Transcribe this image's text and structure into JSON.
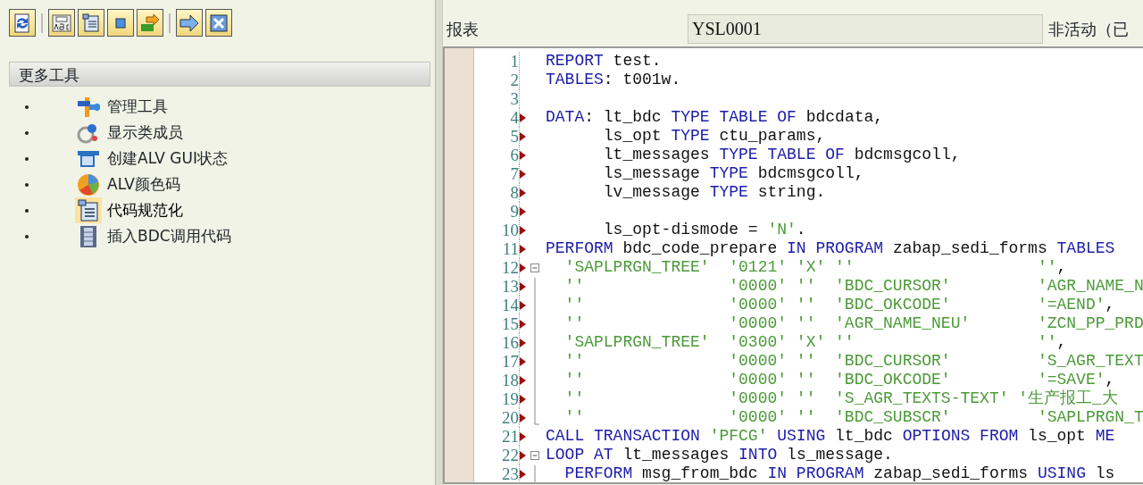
{
  "toolbar": {
    "buttons": [
      {
        "separator_before": false
      },
      {
        "separator_before": true
      },
      {
        "separator_before": false
      },
      {
        "separator_before": false
      },
      {
        "separator_before": false
      },
      {
        "separator_before": true
      },
      {
        "separator_before": false
      }
    ]
  },
  "tools_panel": {
    "title": "更多工具",
    "items": [
      {
        "label": "管理工具",
        "selected": false
      },
      {
        "label": "显示类成员",
        "selected": false
      },
      {
        "label": "创建ALV GUI状态",
        "selected": false
      },
      {
        "label": "ALV颜色码",
        "selected": false
      },
      {
        "label": "代码规范化",
        "selected": true
      },
      {
        "label": "插入BDC调用代码",
        "selected": false
      }
    ]
  },
  "editor_header": {
    "label": "报表",
    "program": "YSL0001",
    "status": "非活动（已"
  },
  "code_lines": [
    {
      "number": "1",
      "marked": false,
      "kind": "plain",
      "tokens": [
        {
          "kind": "keyword",
          "text": "REPORT"
        },
        {
          "kind": "text",
          "text": " test."
        }
      ]
    },
    {
      "number": "2",
      "marked": false,
      "kind": "plain",
      "tokens": [
        {
          "kind": "keyword",
          "text": "TABLES"
        },
        {
          "kind": "text",
          "text": ": t001w."
        }
      ]
    },
    {
      "number": "3",
      "marked": false,
      "kind": "plain"
    },
    {
      "number": "4",
      "marked": true,
      "kind": "plain",
      "tokens": [
        {
          "kind": "keyword",
          "text": "DATA"
        },
        {
          "kind": "text",
          "text": ": lt_bdc "
        },
        {
          "kind": "keyword",
          "text": "TYPE TABLE OF"
        },
        {
          "kind": "text",
          "text": " bdcdata,"
        }
      ]
    },
    {
      "number": "5",
      "marked": true,
      "kind": "plain",
      "tokens": [
        {
          "kind": "text",
          "text": "      ls_opt "
        },
        {
          "kind": "keyword",
          "text": "TYPE"
        },
        {
          "kind": "text",
          "text": " ctu_params,"
        }
      ]
    },
    {
      "number": "6",
      "marked": true,
      "kind": "plain",
      "tokens": [
        {
          "kind": "text",
          "text": "      lt_messages "
        },
        {
          "kind": "keyword",
          "text": "TYPE TABLE OF"
        },
        {
          "kind": "text",
          "text": " bdcmsgcoll,"
        }
      ]
    },
    {
      "number": "7",
      "marked": true,
      "kind": "plain",
      "tokens": [
        {
          "kind": "text",
          "text": "      ls_message "
        },
        {
          "kind": "keyword",
          "text": "TYPE"
        },
        {
          "kind": "text",
          "text": " bdcmsgcoll,"
        }
      ]
    },
    {
      "number": "8",
      "marked": true,
      "kind": "plain",
      "tokens": [
        {
          "kind": "text",
          "text": "      lv_message "
        },
        {
          "kind": "keyword",
          "text": "TYPE"
        },
        {
          "kind": "text",
          "text": " string."
        }
      ]
    },
    {
      "number": "9",
      "marked": true,
      "kind": "plain"
    },
    {
      "number": "10",
      "marked": true,
      "kind": "plain",
      "tokens": [
        {
          "kind": "text",
          "text": "      ls_opt-dismode = "
        },
        {
          "kind": "string",
          "text": "'N'"
        },
        {
          "kind": "text",
          "text": "."
        }
      ]
    },
    {
      "number": "11",
      "marked": true,
      "kind": "plain",
      "tokens": [
        {
          "kind": "keyword",
          "text": "PERFORM"
        },
        {
          "kind": "text",
          "text": " bdc_code_prepare "
        },
        {
          "kind": "keyword",
          "text": "IN PROGRAM"
        },
        {
          "kind": "text",
          "text": " zabap_sedi_forms "
        },
        {
          "kind": "keyword",
          "text": "TABLES"
        }
      ]
    },
    {
      "number": "12",
      "marked": true,
      "kind": "block_start",
      "tokens": [
        {
          "kind": "string",
          "text": "  'SAPLPRGN_TREE'  '0121' 'X' ''                   ''"
        },
        {
          "kind": "text",
          "text": ","
        }
      ]
    },
    {
      "number": "13",
      "marked": true,
      "kind": "block_body",
      "tokens": [
        {
          "kind": "string",
          "text": "  ''               '0000' ''  'BDC_CURSOR'         'AGR_NAME_N"
        }
      ]
    },
    {
      "number": "14",
      "marked": true,
      "kind": "block_body",
      "tokens": [
        {
          "kind": "string",
          "text": "  ''               '0000' ''  'BDC_OKCODE'         '=AEND'"
        },
        {
          "kind": "text",
          "text": ","
        }
      ]
    },
    {
      "number": "15",
      "marked": true,
      "kind": "block_body",
      "tokens": [
        {
          "kind": "string",
          "text": "  ''               '0000' ''  'AGR_NAME_NEU'       'ZCN_PP_PRD"
        }
      ]
    },
    {
      "number": "16",
      "marked": true,
      "kind": "block_body",
      "tokens": [
        {
          "kind": "string",
          "text": "  'SAPLPRGN_TREE'  '0300' 'X' ''                   ''"
        },
        {
          "kind": "text",
          "text": ","
        }
      ]
    },
    {
      "number": "17",
      "marked": true,
      "kind": "block_body",
      "tokens": [
        {
          "kind": "string",
          "text": "  ''               '0000' ''  'BDC_CURSOR'         'S_AGR_TEXT"
        }
      ]
    },
    {
      "number": "18",
      "marked": true,
      "kind": "block_body",
      "tokens": [
        {
          "kind": "string",
          "text": "  ''               '0000' ''  'BDC_OKCODE'         '=SAVE'"
        },
        {
          "kind": "text",
          "text": ","
        }
      ]
    },
    {
      "number": "19",
      "marked": true,
      "kind": "block_body",
      "tokens": [
        {
          "kind": "string",
          "text": "  ''               '0000' ''  'S_AGR_TEXTS-TEXT' '生产报工_大"
        }
      ]
    },
    {
      "number": "20",
      "marked": true,
      "kind": "block_end",
      "tokens": [
        {
          "kind": "string",
          "text": "  ''               '0000' ''  'BDC_SUBSCR'         'SAPLPRGN_T"
        }
      ]
    },
    {
      "number": "21",
      "marked": true,
      "kind": "plain",
      "tokens": [
        {
          "kind": "keyword",
          "text": "CALL TRANSACTION"
        },
        {
          "kind": "string",
          "text": " 'PFCG'"
        },
        {
          "kind": "keyword",
          "text": " USING"
        },
        {
          "kind": "text",
          "text": " lt_bdc "
        },
        {
          "kind": "keyword",
          "text": "OPTIONS FROM"
        },
        {
          "kind": "text",
          "text": " ls_opt "
        },
        {
          "kind": "keyword",
          "text": "ME"
        }
      ]
    },
    {
      "number": "22",
      "marked": true,
      "kind": "block_start",
      "tokens": [
        {
          "kind": "keyword",
          "text": "LOOP AT"
        },
        {
          "kind": "text",
          "text": " lt_messages "
        },
        {
          "kind": "keyword",
          "text": "INTO"
        },
        {
          "kind": "text",
          "text": " ls_message."
        }
      ]
    },
    {
      "number": "23",
      "marked": true,
      "kind": "block_body",
      "tokens": [
        {
          "kind": "keyword",
          "text": "  PERFORM"
        },
        {
          "kind": "text",
          "text": " msg_from_bdc "
        },
        {
          "kind": "keyword",
          "text": "IN PROGRAM"
        },
        {
          "kind": "text",
          "text": " zabap_sedi_forms "
        },
        {
          "kind": "keyword",
          "text": "USING"
        },
        {
          "kind": "text",
          "text": " ls"
        }
      ]
    }
  ]
}
